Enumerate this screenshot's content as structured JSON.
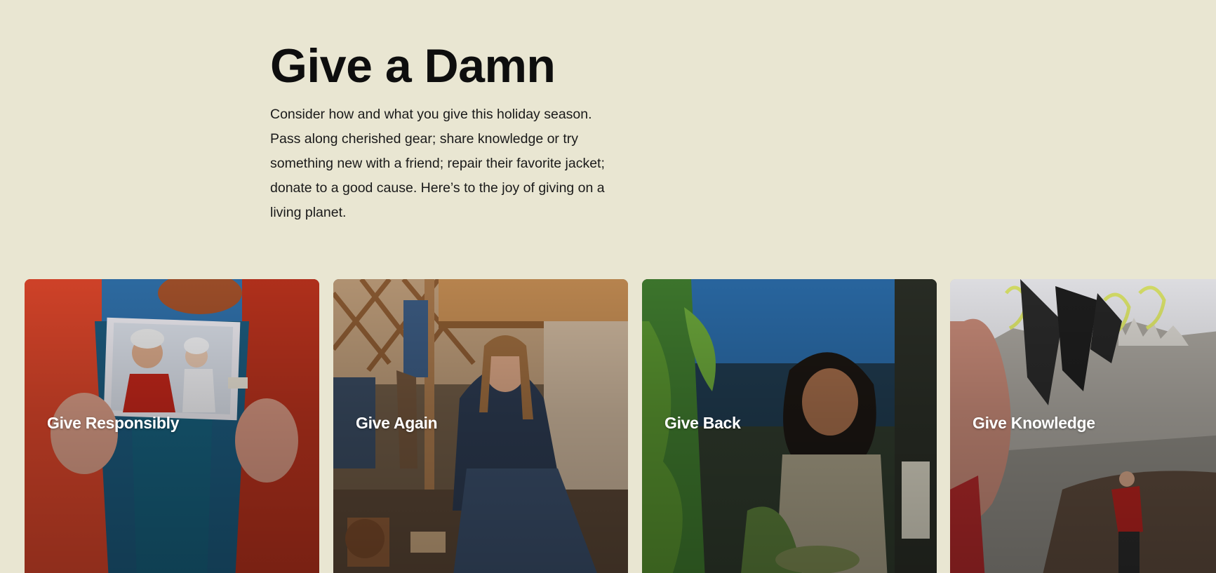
{
  "hero": {
    "title": "Give a Damn",
    "body": "Consider how and what you give this holiday season. Pass along cherished gear; share knowledge or try something new with a friend; repair their favorite jacket; donate to a good cause. Here’s to the joy of giving on a living planet."
  },
  "cards": [
    {
      "label": "Give Responsibly",
      "photo": "person-holding-photo-in-red-jacket"
    },
    {
      "label": "Give Again",
      "photo": "woman-repairing-gear-in-yurt"
    },
    {
      "label": "Give Back",
      "photo": "woman-gardening-outdoors"
    },
    {
      "label": "Give Knowledge",
      "photo": "climbing-gear-and-climber"
    }
  ]
}
